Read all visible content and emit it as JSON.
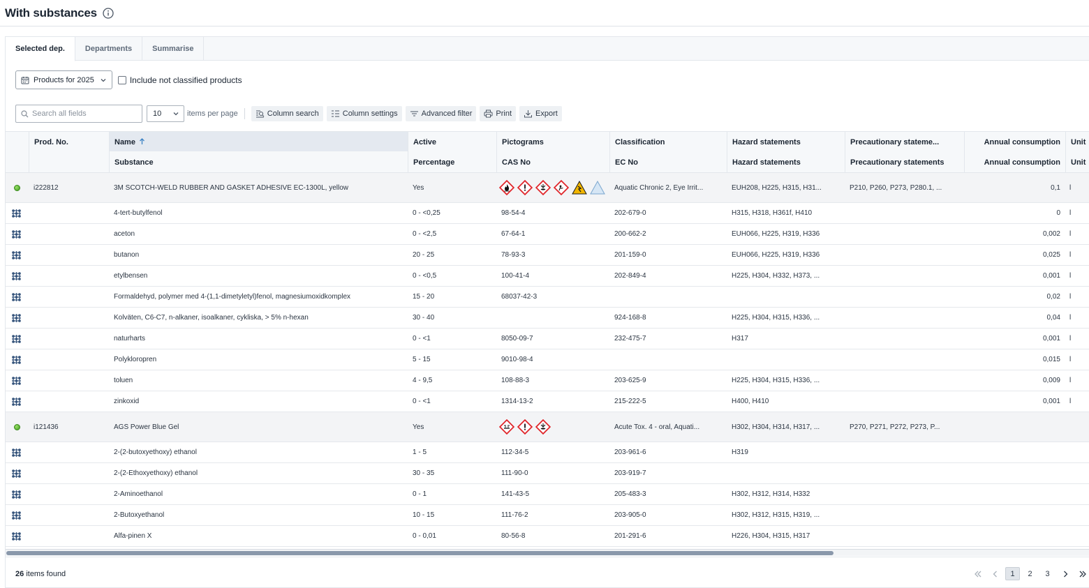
{
  "page": {
    "title": "With substances"
  },
  "tabs": [
    {
      "label": "Selected dep.",
      "active": true
    },
    {
      "label": "Departments",
      "active": false
    },
    {
      "label": "Summarise",
      "active": false
    }
  ],
  "filter": {
    "year_select": "Products for 2025",
    "include_not_classified": "Include not classified products"
  },
  "toolbar": {
    "search_placeholder": "Search all fields",
    "per_page_value": "10",
    "per_page_label": "items per page",
    "column_search": "Column search",
    "column_settings": "Column settings",
    "advanced_filter": "Advanced filter",
    "print": "Print",
    "export": "Export"
  },
  "columns": {
    "prod_no": "Prod. No.",
    "name": "Name",
    "substance": "Substance",
    "active": "Active",
    "percentage": "Percentage",
    "pictograms": "Pictograms",
    "cas_no": "CAS No",
    "classification": "Classification",
    "ec_no": "EC No",
    "hazard": "Hazard statements",
    "hazard2": "Hazard statements",
    "precaution": "Precautionary stateme...",
    "precaution2": "Precautionary statements",
    "annual": "Annual consumption",
    "annual2": "Annual consumption",
    "unit": "Unit",
    "unit2": "Unit"
  },
  "rows": [
    {
      "type": "product",
      "prod_no": "i222812",
      "name": "3M SCOTCH-WELD RUBBER AND GASKET ADHESIVE EC-1300L, yellow",
      "active": "Yes",
      "pictograms": [
        "flame",
        "exclamation",
        "environment",
        "health-hazard",
        "warning-yellow",
        "triangle-blue"
      ],
      "classification": "Aquatic Chronic 2, Eye Irrit...",
      "hazard": "EUH208, H225, H315, H31...",
      "precaution": "P210, P260, P273, P280.1, ...",
      "annual": "0,1",
      "unit": "l"
    },
    {
      "type": "substance",
      "name": "4-tert-butylfenol",
      "percentage": "0 - <0,25",
      "cas": "98-54-4",
      "ec": "202-679-0",
      "hazard": "H315, H318, H361f, H410",
      "annual": "0",
      "unit": "l"
    },
    {
      "type": "substance",
      "name": "aceton",
      "percentage": "0 - <2,5",
      "cas": "67-64-1",
      "ec": "200-662-2",
      "hazard": "EUH066, H225, H319, H336",
      "annual": "0,002",
      "unit": "l"
    },
    {
      "type": "substance",
      "name": "butanon",
      "percentage": "20 - 25",
      "cas": "78-93-3",
      "ec": "201-159-0",
      "hazard": "EUH066, H225, H319, H336",
      "annual": "0,025",
      "unit": "l"
    },
    {
      "type": "substance",
      "name": "etylbensen",
      "percentage": "0 - <0,5",
      "cas": "100-41-4",
      "ec": "202-849-4",
      "hazard": "H225, H304, H332, H373, ...",
      "annual": "0,001",
      "unit": "l"
    },
    {
      "type": "substance",
      "name": "Formaldehyd, polymer med 4-(1,1-dimetyletyl)fenol, magnesiumoxidkomplex",
      "percentage": "15 - 20",
      "cas": "68037-42-3",
      "ec": "",
      "hazard": "",
      "annual": "0,02",
      "unit": "l"
    },
    {
      "type": "substance",
      "name": "Kolväten, C6-C7, n-alkaner, isoalkaner, cykliska, > 5% n-hexan",
      "percentage": "30 - 40",
      "cas": "",
      "ec": "924-168-8",
      "hazard": "H225, H304, H315, H336, ...",
      "annual": "0,04",
      "unit": "l"
    },
    {
      "type": "substance",
      "name": "naturharts",
      "percentage": "0 - <1",
      "cas": "8050-09-7",
      "ec": "232-475-7",
      "hazard": "H317",
      "annual": "0,001",
      "unit": "l"
    },
    {
      "type": "substance",
      "name": "Polykloropren",
      "percentage": "5 - 15",
      "cas": "9010-98-4",
      "ec": "",
      "hazard": "",
      "annual": "0,015",
      "unit": "l"
    },
    {
      "type": "substance",
      "name": "toluen",
      "percentage": "4 - 9,5",
      "cas": "108-88-3",
      "ec": "203-625-9",
      "hazard": "H225, H304, H315, H336, ...",
      "annual": "0,009",
      "unit": "l"
    },
    {
      "type": "substance",
      "name": "zinkoxid",
      "percentage": "0 - <1",
      "cas": "1314-13-2",
      "ec": "215-222-5",
      "hazard": "H400, H410",
      "annual": "0,001",
      "unit": "l"
    },
    {
      "type": "product",
      "prod_no": "i121436",
      "name": "AGS Power Blue Gel",
      "active": "Yes",
      "pictograms": [
        "corrosion",
        "exclamation",
        "environment"
      ],
      "classification": "Acute Tox. 4 - oral, Aquati...",
      "hazard": "H302, H304, H314, H317, ...",
      "precaution": "P270, P271, P272, P273, P...",
      "annual": "",
      "unit": ""
    },
    {
      "type": "substance",
      "name": "2-(2-butoxyethoxy) ethanol",
      "percentage": "1 - 5",
      "cas": "112-34-5",
      "ec": "203-961-6",
      "hazard": "H319",
      "annual": "",
      "unit": ""
    },
    {
      "type": "substance",
      "name": "2-(2-Ethoxyethoxy) ethanol",
      "percentage": "30 - 35",
      "cas": "111-90-0",
      "ec": "203-919-7",
      "hazard": "",
      "annual": "",
      "unit": ""
    },
    {
      "type": "substance",
      "name": "2-Aminoethanol",
      "percentage": "0 - 1",
      "cas": "141-43-5",
      "ec": "205-483-3",
      "hazard": "H302, H312, H314, H332",
      "annual": "",
      "unit": ""
    },
    {
      "type": "substance",
      "name": "2-Butoxyethanol",
      "percentage": "10 - 15",
      "cas": "111-76-2",
      "ec": "203-905-0",
      "hazard": "H302, H312, H315, H319, ...",
      "annual": "",
      "unit": ""
    },
    {
      "type": "substance",
      "name": "Alfa-pinen X",
      "percentage": "0 - 0,01",
      "cas": "80-56-8",
      "ec": "201-291-6",
      "hazard": "H226, H304, H315, H317",
      "annual": "",
      "unit": ""
    }
  ],
  "footer": {
    "count": "26",
    "found_label": "items found",
    "pages": [
      "1",
      "2",
      "3"
    ],
    "current_page": "1"
  },
  "colors": {
    "accent": "#3b82c4",
    "ghs_red": "#e0262b",
    "status_green": "#4caf2a"
  }
}
